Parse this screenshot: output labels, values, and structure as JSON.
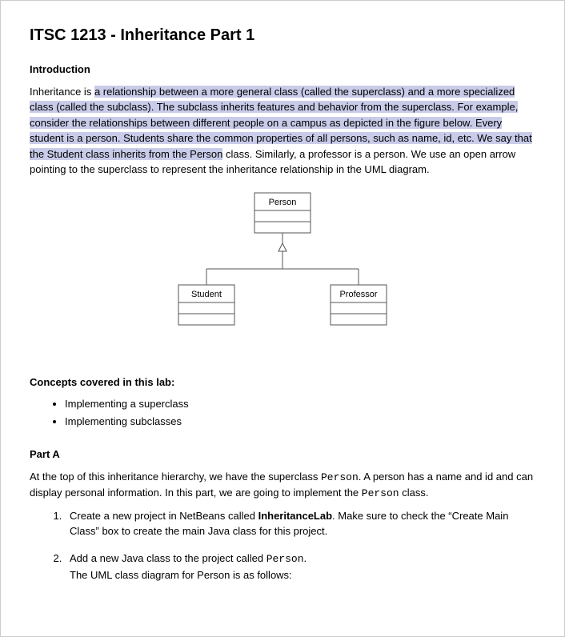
{
  "title": "ITSC 1213 - Inheritance Part 1",
  "intro": {
    "heading": "Introduction",
    "before_highlight": "Inheritance is ",
    "highlight": "a relationship between a more general class (called the superclass) and a more specialized class (called the subclass). The subclass inherits features and behavior from the superclass. For example, consider the relationships between different people on a campus as depicted in the figure below. Every student is a person. Students share the common properties of all persons, such as name, id, etc. We say that the Student class inherits from the Person",
    "after_highlight": " class. Similarly, a professor is a person. We use an open arrow pointing to the superclass to represent the inheritance relationship in the UML diagram."
  },
  "diagram": {
    "superclass": "Person",
    "subclass_left": "Student",
    "subclass_right": "Professor"
  },
  "concepts": {
    "heading": "Concepts covered in this lab:",
    "items": [
      "Implementing a superclass",
      "Implementing subclasses"
    ]
  },
  "partA": {
    "heading": "Part A",
    "para_1a": "At the top of this inheritance hierarchy, we have the superclass ",
    "para_1b": ". A person has a name and id and can display personal information. In this part, we are going to implement the ",
    "para_1c": " class.",
    "code_person": "Person",
    "step1a": "Create a new project in NetBeans called ",
    "step1_bold": "InheritanceLab",
    "step1b": ". Make sure to check the “Create Main Class” box to create the main Java class for this project.",
    "step2a": "Add a new Java class to the project called ",
    "step2b": ".",
    "step2c": "The UML class diagram for Person is as follows:"
  }
}
